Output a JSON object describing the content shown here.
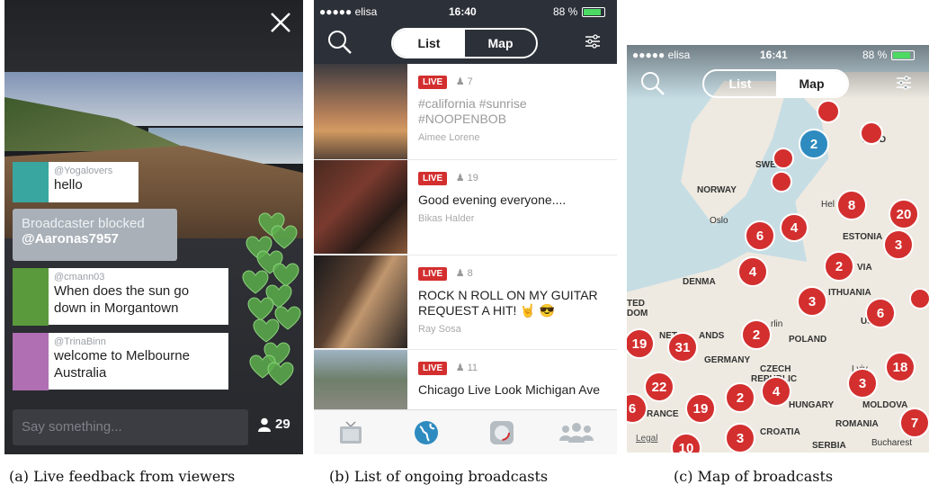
{
  "panel_a": {
    "comments": [
      {
        "user": "@Yogalovers",
        "text": "hello",
        "avatar_color": "#3aa6a0"
      },
      {
        "user": "@cmann03",
        "text": "When does the sun go down in Morgantown",
        "avatar_color": "#5a9a3c"
      },
      {
        "user": "@TrinaBinn",
        "text": "welcome to Melbourne Australia",
        "avatar_color": "#b06fb3"
      }
    ],
    "blocked_line1": "Broadcaster blocked",
    "blocked_line2": "@Aaronas7957",
    "say_placeholder": "Say something...",
    "viewer_count": "29",
    "heart_color": "#5cae4c"
  },
  "panel_b": {
    "status_carrier": "●●●●● elisa",
    "status_time": "16:40",
    "status_battery": "88 %",
    "tab_list": "List",
    "tab_map": "Map",
    "broadcasts": [
      {
        "badge": "LIVE",
        "viewers": "7",
        "title": "#california #sunrise #NOOPENBOB",
        "author": "Aimee Lorene",
        "muted": true
      },
      {
        "badge": "LIVE",
        "viewers": "19",
        "title": "Good evening everyone....",
        "author": "Bikas Halder",
        "muted": false
      },
      {
        "badge": "LIVE",
        "viewers": "8",
        "title": "ROCK N ROLL ON MY GUITAR REQUEST A HIT! 🤘 😎",
        "author": "Ray Sosa",
        "muted": false
      },
      {
        "badge": "LIVE",
        "viewers": "11",
        "title": "Chicago Live Look Michigan Ave",
        "author": "",
        "muted": false
      }
    ],
    "accent": "#d32f2f",
    "nav_color": "#2c3038"
  },
  "panel_c": {
    "status_carrier": "●●●●● elisa",
    "status_time": "16:41",
    "status_battery": "88 %",
    "tab_list": "List",
    "tab_map": "Map",
    "labels": {
      "sweden": "SWED",
      "finland": "FI  ND",
      "norway": "NORWAY",
      "oslo": "Oslo",
      "helsinki": "Hel",
      "estonia": "ESTONIA",
      "latvia": "VIA",
      "denmark": "DENMA",
      "lithuania": "ITHUANIA",
      "ted": "TED",
      "dom": "DOM",
      "berlin": "rlin",
      "poland": "POLAND",
      "net": "NET",
      "ands": "ANDS",
      "germany": "GERMANY",
      "czech1": "CZECH",
      "czech2": "REPUBLIC",
      "lviv": "Lviv",
      "hungary": "HUNGARY",
      "moldova": "MOLDOVA",
      "rance": "RANCE",
      "romania": "ROMANIA",
      "croatia": "CROATIA",
      "serbia": "SERBIA",
      "bucharest": "Bucharest",
      "legal": "Legal",
      "us": "US"
    },
    "clusters": [
      "2",
      "8",
      "20",
      "6",
      "4",
      "3",
      "4",
      "2",
      "3",
      "6",
      "2",
      "19",
      "31",
      "18",
      "22",
      "3",
      "2",
      "4",
      "6",
      "19",
      "7",
      "3",
      "10",
      "",
      "",
      "",
      "",
      "",
      ""
    ]
  },
  "captions": {
    "a": "(a) Live feedback from viewers",
    "b": "(b) List of ongoing broadcasts",
    "c": "(c) Map of broadcasts"
  }
}
